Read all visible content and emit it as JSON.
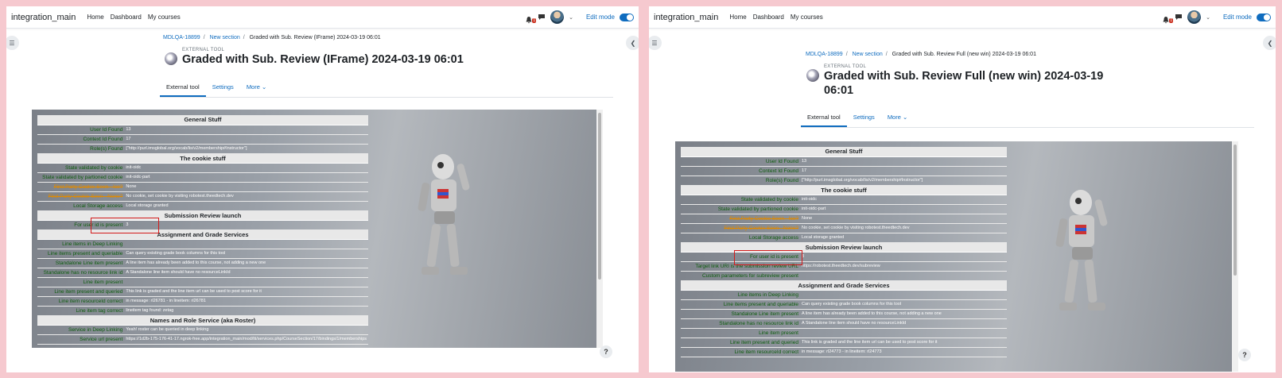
{
  "left": {
    "nav": {
      "brand": "integration_main",
      "links": [
        "Home",
        "Dashboard",
        "My courses"
      ],
      "notif_count": "1",
      "edit_mode": "Edit mode"
    },
    "breadcrumb": [
      "MDLQA-18899",
      "New section",
      "Graded with Sub. Review (IFrame) 2024-03-19 06:01"
    ],
    "kind": "EXTERNAL TOOL",
    "title": "Graded with Sub. Review (IFrame) 2024-03-19 06:01",
    "tabs": [
      "External tool",
      "Settings",
      "More ⌄"
    ],
    "rows": [
      {
        "type": "section",
        "label": "General Stuff"
      },
      {
        "label": "User Id Found",
        "value": "13"
      },
      {
        "label": "Context Id Found",
        "value": "17"
      },
      {
        "label": "Role(s) Found",
        "value": "[\"http://purl.imsglobal.org/vocab/lis/v2/membership#Instructor\"]"
      },
      {
        "type": "section",
        "label": "The cookie stuff"
      },
      {
        "label": "State validated by cookie",
        "value": "init-oidc"
      },
      {
        "label": "State validated by partioned cookie",
        "value": "init-oidc-part"
      },
      {
        "label": "First Party Cookie Seen - Ice?",
        "value": "None",
        "style": "orange"
      },
      {
        "label": "First Party Cookie Seen - None?",
        "value": "No cookie, set cookie by visiting robotest.theedtech.dev",
        "style": "orange"
      },
      {
        "label": "Local Storage access",
        "value": "Local storage granted"
      },
      {
        "type": "section",
        "label": "Submission Review launch"
      },
      {
        "label": "For user id is present",
        "value": "3"
      },
      {
        "type": "section",
        "label": "Assignment and Grade Services"
      },
      {
        "label": "Line items in Deep Linking",
        "value": ""
      },
      {
        "label": "Line items present and queriable",
        "value": "Can query existing grade book columns for this tool"
      },
      {
        "label": "Standalone Line item present",
        "value": "A line item has already been added to this course, not adding a new one"
      },
      {
        "label": "Standalone has no resource link id",
        "value": "A Standalone line item should have no resourceLinkId"
      },
      {
        "label": "Line item present",
        "value": ""
      },
      {
        "label": "Line item present and queried",
        "value": "This link is graded and the line item url can be used to post score for it"
      },
      {
        "label": "Line item resourceId correct",
        "value": "in message: rl26781 - in lineitem: rl26781"
      },
      {
        "label": "Line item tag correct",
        "value": "lineitem tag found: zetag"
      },
      {
        "type": "section",
        "label": "Names and Role Service (aka Roster)"
      },
      {
        "label": "Service in Deep Linking",
        "value": "Yeah! roster can be queried in deep linking"
      },
      {
        "label": "Service url present",
        "value": "https://1d2b-175-176-41-17.ngrok-free.app/integration_main/mod/lti/services.php/CourseSection/17/bindings/1/memberships"
      }
    ]
  },
  "right": {
    "nav": {
      "brand": "integration_main",
      "links": [
        "Home",
        "Dashboard",
        "My courses"
      ],
      "notif_count": "1",
      "edit_mode": "Edit mode"
    },
    "breadcrumb": [
      "MDLQA-18899",
      "New section",
      "Graded with Sub. Review Full (new win) 2024-03-19 06:01"
    ],
    "kind": "EXTERNAL TOOL",
    "title_line1": "Graded with Sub. Review Full (new win) 2024-03-19",
    "title_line2": "06:01",
    "tabs": [
      "External tool",
      "Settings",
      "More ⌄"
    ],
    "rows": [
      {
        "type": "section",
        "label": "General Stuff"
      },
      {
        "label": "User Id Found",
        "value": "13"
      },
      {
        "label": "Context Id Found",
        "value": "17"
      },
      {
        "label": "Role(s) Found",
        "value": "[\"http://purl.imsglobal.org/vocab/lis/v2/membership#Instructor\"]"
      },
      {
        "type": "section",
        "label": "The cookie stuff"
      },
      {
        "label": "State validated by cookie",
        "value": "init-oidc"
      },
      {
        "label": "State validated by partioned cookie",
        "value": "init-oidc-part"
      },
      {
        "label": "First Party Cookie Seen - Ice?",
        "value": "None",
        "style": "orange"
      },
      {
        "label": "First Party Cookie Seen - None?",
        "value": "No cookie, set cookie by visiting robotest.theedtech.dev",
        "style": "orange"
      },
      {
        "label": "Local Storage access",
        "value": "Local storage granted"
      },
      {
        "type": "section",
        "label": "Submission Review launch"
      },
      {
        "label": "For user id is present",
        "value": "3"
      },
      {
        "label": "Target link URI is the submission review URL",
        "value": "https://robotest.theedtech.dev/subreview"
      },
      {
        "label": "Custom parameters for subreview present",
        "value": ""
      },
      {
        "type": "section",
        "label": "Assignment and Grade Services"
      },
      {
        "label": "Line items in Deep Linking",
        "value": ""
      },
      {
        "label": "Line items present and queriable",
        "value": "Can query existing grade book columns for this tool"
      },
      {
        "label": "Standalone Line item present",
        "value": "A line item has already been added to this course, not adding a new one"
      },
      {
        "label": "Standalone has no resource link id",
        "value": "A Standalone line item should have no resourceLinkId"
      },
      {
        "label": "Line item present",
        "value": ""
      },
      {
        "label": "Line item present and queried",
        "value": "This link is graded and the line item url can be used to post score for it"
      },
      {
        "label": "Line item resourceId correct",
        "value": "in message: rl24773 - in lineitem: rl24773"
      }
    ]
  },
  "colors": {
    "link": "#0f6cbf",
    "ok": "#0d5c0d",
    "warn": "#e08a00",
    "highlight": "#d41a1a"
  }
}
